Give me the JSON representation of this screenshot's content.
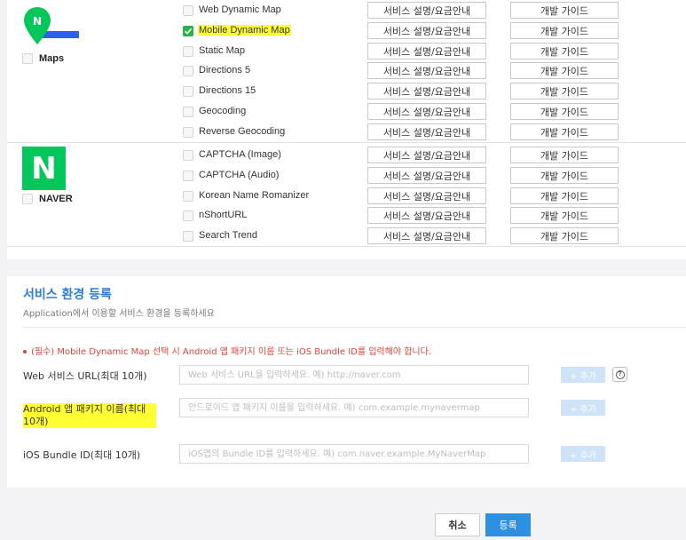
{
  "groups": {
    "maps": {
      "label": "Maps",
      "apis": [
        {
          "name": "Web Dynamic Map",
          "checked": false,
          "highlighted": false
        },
        {
          "name": "Mobile Dynamic Map",
          "checked": true,
          "highlighted": true
        },
        {
          "name": "Static Map",
          "checked": false,
          "highlighted": false
        },
        {
          "name": "Directions 5",
          "checked": false,
          "highlighted": false
        },
        {
          "name": "Directions 15",
          "checked": false,
          "highlighted": false
        },
        {
          "name": "Geocoding",
          "checked": false,
          "highlighted": false
        },
        {
          "name": "Reverse Geocoding",
          "checked": false,
          "highlighted": false
        }
      ]
    },
    "naver": {
      "label": "NAVER",
      "logo_letter": "N",
      "apis": [
        {
          "name": "CAPTCHA (Image)",
          "checked": false
        },
        {
          "name": "CAPTCHA (Audio)",
          "checked": false
        },
        {
          "name": "Korean Name Romanizer",
          "checked": false
        },
        {
          "name": "nShortURL",
          "checked": false
        },
        {
          "name": "Search Trend",
          "checked": false
        }
      ]
    }
  },
  "row_buttons": {
    "desc": "서비스 설명/요금안내",
    "guide": "개발 가이드"
  },
  "registration": {
    "title": "서비스 환경 등록",
    "subtitle": "Application에서 이용할 서비스 환경을 등록하세요",
    "notice": "(필수) Mobile Dynamic Map 선택 시 Android 앱 패키지 이름 또는 iOS Bundle ID를 입력해야 합니다.",
    "fields": {
      "web": {
        "label": "Web 서비스 URL(최대 10개)",
        "placeholder": "Web 서비스 URL을 입력하세요. 예) http://naver.com"
      },
      "android": {
        "label": "Android 앱 패키지 이름(최대 10개)",
        "placeholder": "안드로이드 앱 패키지 이름을 입력하세요. 예) com.example.mynavermap"
      },
      "ios": {
        "label": "iOS Bundle ID(최대 10개)",
        "placeholder": "iOS앱의 Bundle ID를 입력하세요. 예) com.naver.example.MyNaverMap"
      }
    },
    "add_label": "+ 추가",
    "help_glyph": "?"
  },
  "footer": {
    "cancel": "취소",
    "submit": "등록"
  },
  "colors": {
    "accent_blue": "#2f7bd8",
    "submit_blue": "#2f8fe0",
    "naver_green": "#03c75a",
    "check_green": "#29b34a",
    "notice_red": "#e0443a",
    "highlight_yellow": "#ffff33"
  }
}
